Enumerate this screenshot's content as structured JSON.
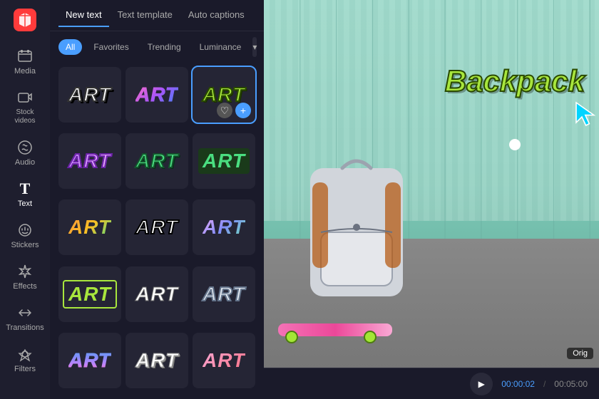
{
  "app": {
    "logo_label": "CapCut"
  },
  "sidebar": {
    "items": [
      {
        "id": "media",
        "label": "Media",
        "icon": "🎬"
      },
      {
        "id": "stock-videos",
        "label": "Stock videos",
        "icon": "🎞"
      },
      {
        "id": "audio",
        "label": "Audio",
        "icon": "🎵"
      },
      {
        "id": "text",
        "label": "Text",
        "icon": "T",
        "active": true
      },
      {
        "id": "stickers",
        "label": "Stickers",
        "icon": "🌟"
      },
      {
        "id": "effects",
        "label": "Effects",
        "icon": "✦"
      },
      {
        "id": "transitions",
        "label": "Transitions",
        "icon": "⟷"
      },
      {
        "id": "filters",
        "label": "Filters",
        "icon": "⬡"
      }
    ]
  },
  "tabs": [
    {
      "id": "new-text",
      "label": "New text",
      "active": true
    },
    {
      "id": "text-template",
      "label": "Text template",
      "active": false
    },
    {
      "id": "auto-captions",
      "label": "Auto captions",
      "active": false
    }
  ],
  "filters": [
    {
      "id": "all",
      "label": "All",
      "active": true
    },
    {
      "id": "favorites",
      "label": "Favorites",
      "active": false
    },
    {
      "id": "trending",
      "label": "Trending",
      "active": false
    },
    {
      "id": "luminance",
      "label": "Luminance",
      "active": false
    }
  ],
  "text_cards": [
    {
      "id": 1,
      "label": "ART",
      "style": "style-1"
    },
    {
      "id": 2,
      "label": "ART",
      "style": "style-2"
    },
    {
      "id": 3,
      "label": "ART",
      "style": "style-3",
      "selected": true
    },
    {
      "id": 4,
      "label": "ART",
      "style": "style-4"
    },
    {
      "id": 5,
      "label": "ART",
      "style": "style-5"
    },
    {
      "id": 6,
      "label": "ART",
      "style": "style-6"
    },
    {
      "id": 7,
      "label": "ART",
      "style": "style-7"
    },
    {
      "id": 8,
      "label": "ART",
      "style": "style-8"
    },
    {
      "id": 9,
      "label": "ART",
      "style": "style-9"
    },
    {
      "id": 10,
      "label": "ART",
      "style": "style-10"
    },
    {
      "id": 11,
      "label": "ART",
      "style": "style-11"
    },
    {
      "id": 12,
      "label": "ART",
      "style": "style-12"
    },
    {
      "id": 13,
      "label": "ART",
      "style": "style-13"
    },
    {
      "id": 14,
      "label": "ART",
      "style": "style-14"
    },
    {
      "id": 15,
      "label": "ART",
      "style": "style-15"
    }
  ],
  "preview": {
    "text": "Backpack",
    "current_time": "00:00:02",
    "total_time": "00:05:00",
    "orig_label": "Orig"
  }
}
